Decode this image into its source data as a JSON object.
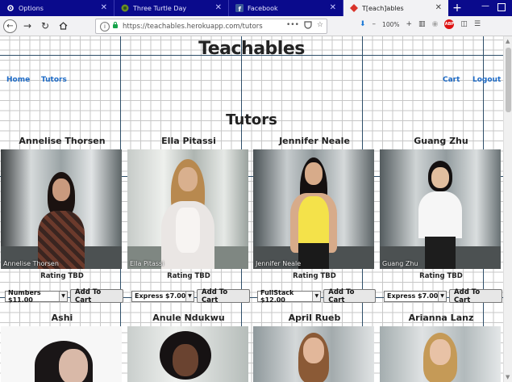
{
  "browser": {
    "tabs": [
      {
        "label": "Options",
        "icon": "gear-icon"
      },
      {
        "label": "Three Turtle Day",
        "icon": "turtle-icon"
      },
      {
        "label": "Facebook",
        "icon": "facebook-icon"
      },
      {
        "label": "T[each]ables",
        "icon": "teachables-icon",
        "active": true
      }
    ],
    "new_tab_label": "+",
    "url": "https://teachables.herokuapp.com/tutors",
    "url_more": "•••",
    "zoom": "100%",
    "zoom_plus": "+",
    "zoom_minus": "–",
    "adblock_label": "ABP",
    "scroll_up": "▲",
    "scroll_down": "▼"
  },
  "site": {
    "title": "Teachables",
    "nav": {
      "home": "Home",
      "tutors": "Tutors",
      "cart": "Cart",
      "logout": "Logout"
    },
    "section_title": "Tutors"
  },
  "tutors": [
    {
      "name": "Annelise Thorsen",
      "caption": "Annelise Thorsen",
      "rating": "Rating TBD",
      "selected_option": "Numbers $11.00",
      "button": "Add To Cart"
    },
    {
      "name": "Ella Pitassi",
      "caption": "Ella Pitassi",
      "rating": "Rating TBD",
      "selected_option": "Express $7.00",
      "button": "Add To Cart"
    },
    {
      "name": "Jennifer Neale",
      "caption": "Jennifer Neale",
      "rating": "Rating TBD",
      "selected_option": "FullStack $12.00",
      "button": "Add To Cart"
    },
    {
      "name": "Guang Zhu",
      "caption": "Guang Zhu",
      "rating": "Rating TBD",
      "selected_option": "Express $7.00",
      "button": "Add To Cart"
    },
    {
      "name": "Ashi"
    },
    {
      "name": "Anule Ndukwu"
    },
    {
      "name": "April Rueb"
    },
    {
      "name": "Arianna Lanz"
    }
  ],
  "colors": {
    "link": "#1e6bc6",
    "tabbar": "#0a0a8c",
    "grid_major": "#2f4f6a",
    "grid_minor": "#c7c7c7"
  }
}
